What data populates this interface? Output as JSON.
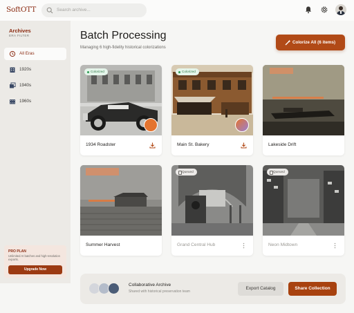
{
  "app": {
    "brand": "SoftOTT"
  },
  "search": {
    "placeholder": "Search archive..."
  },
  "sidebar": {
    "title": "Archives",
    "subtitle": "ERA FILTER",
    "items": [
      {
        "label": "All Eras",
        "icon": "history-icon",
        "active": true
      },
      {
        "label": "1920s",
        "icon": "building-icon",
        "active": false
      },
      {
        "label": "1940s",
        "icon": "gallery-icon",
        "active": false
      },
      {
        "label": "1960s",
        "icon": "film-icon",
        "active": false
      }
    ],
    "pro": {
      "title": "PRO PLAN",
      "desc": "Unlimited AI batches and high-resolution exports.",
      "button": "Upgrade Now"
    }
  },
  "main": {
    "title": "Batch Processing",
    "subtitle": "Managing 6 high-fidelity historical colorizations",
    "colorize_button": "Colorize All (6 items)"
  },
  "cards": [
    {
      "title": "1934 Roadster",
      "status": "Colorized",
      "action_icon": "download-icon"
    },
    {
      "title": "Main St. Bakery",
      "status": "Colorized",
      "action_icon": "download-icon"
    },
    {
      "title": "Lakeside Drift",
      "status": "",
      "action_icon": ""
    },
    {
      "title": "Summer Harvest",
      "status": "",
      "action_icon": ""
    },
    {
      "title": "Grand Central Hub",
      "status": "Queued",
      "action_icon": "more-vertical-icon"
    },
    {
      "title": "Neon Midtown",
      "status": "Queued",
      "action_icon": "more-vertical-icon"
    }
  ],
  "collab": {
    "title": "Collaborative Archive",
    "desc": "Shared with historical preservation team",
    "export_button": "Export Catalog",
    "share_button": "Share Collection"
  },
  "colors": {
    "brand": "#8a2a10",
    "accent": "#b14a17",
    "success": "#39a35e"
  }
}
